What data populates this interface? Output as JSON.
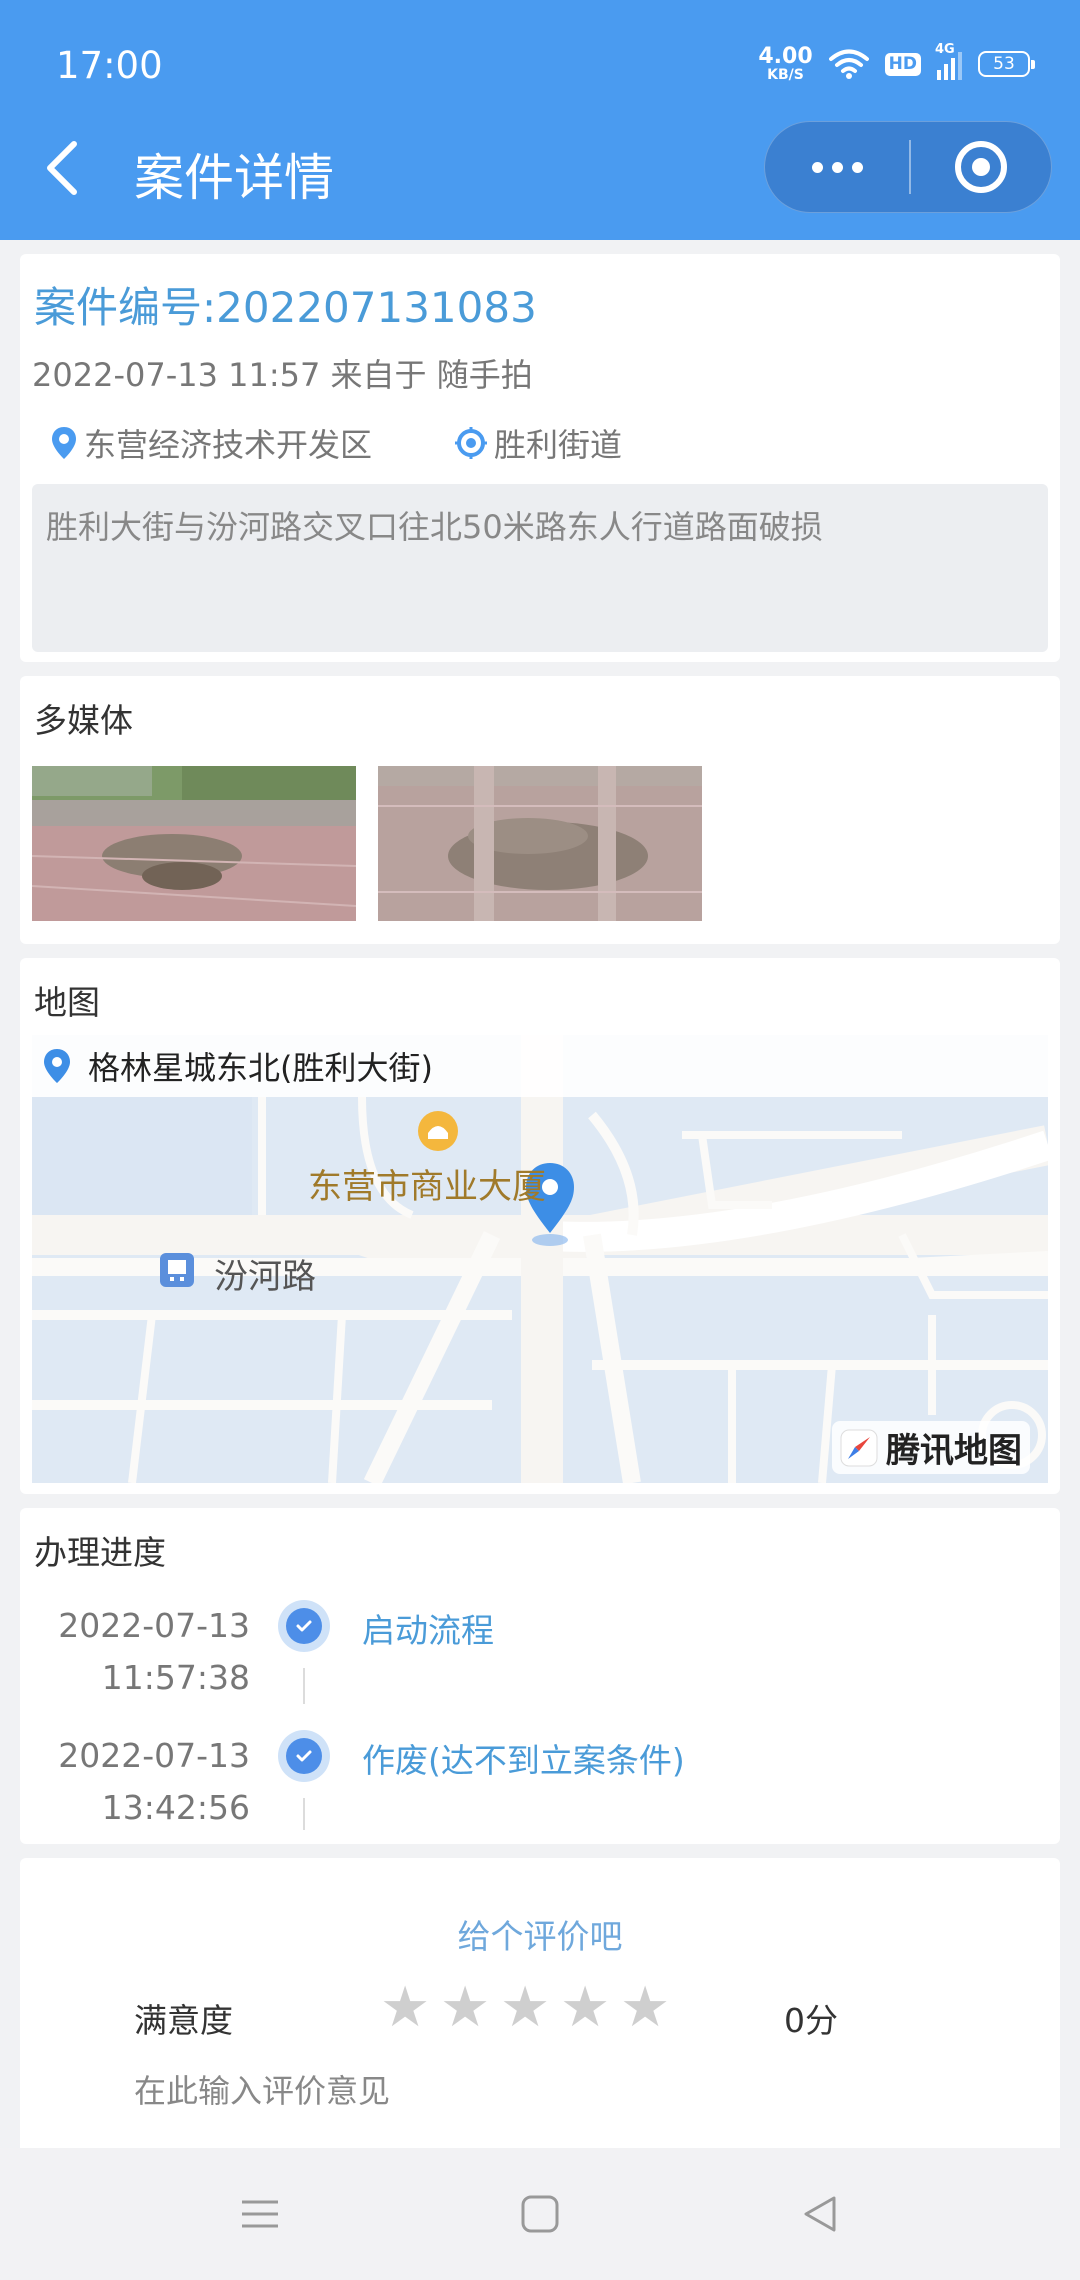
{
  "status_bar": {
    "time": "17:00",
    "net_speed_value": "4.00",
    "net_speed_unit": "KB/S",
    "hd_label": "HD",
    "network_label": "4G",
    "battery": "53"
  },
  "header": {
    "title": "案件详情",
    "accent_color": "#4a9bf0"
  },
  "case": {
    "number": "案件编号:202207131083",
    "meta": "2022-07-13 11:57 来自于 随手拍",
    "district": "东营经济技术开发区",
    "street": "胜利街道",
    "description": "胜利大街与汾河路交叉口往北50米路东人行道路面破损"
  },
  "media": {
    "title": "多媒体"
  },
  "map": {
    "title": "地图",
    "address": "格林星城东北(胜利大街)",
    "poi_label": "东营市商业大厦",
    "road_label": "汾河路",
    "logo_label": "腾讯地图"
  },
  "progress": {
    "title": "办理进度",
    "steps": [
      {
        "date": "2022-07-13",
        "time": "11:57:38",
        "label": "启动流程"
      },
      {
        "date": "2022-07-13",
        "time": "13:42:56",
        "label": "作废(达不到立案条件)"
      }
    ]
  },
  "rating": {
    "title": "给个评价吧",
    "label": "满意度",
    "score": "0分",
    "stars_filled": 0,
    "stars_total": 5,
    "placeholder": "在此输入评价意见"
  }
}
